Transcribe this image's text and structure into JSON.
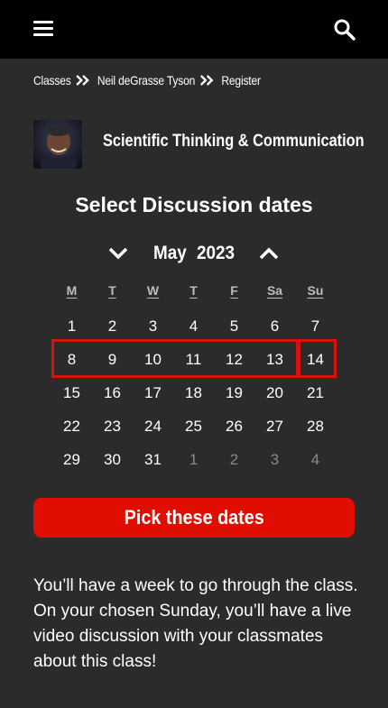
{
  "header": {
    "menu_icon": "hamburger-menu-icon",
    "search_icon": "search-icon"
  },
  "breadcrumb": {
    "items": [
      "Classes",
      "Neil deGrasse Tyson",
      "Register"
    ],
    "separator_icon": "double-chevron-right-icon"
  },
  "class": {
    "title": "Scientific Thinking & Communication",
    "thumbnail": "instructor-portrait"
  },
  "picker": {
    "heading": "Select Discussion dates",
    "month": "May",
    "year": "2023",
    "prev_icon": "chevron-down-icon",
    "next_icon": "chevron-up-icon",
    "weekdays": [
      "M",
      "T",
      "W",
      "T",
      "F",
      "Sa",
      "Su"
    ],
    "weeks": [
      [
        "1",
        "2",
        "3",
        "4",
        "5",
        "6",
        "7"
      ],
      [
        "8",
        "9",
        "10",
        "11",
        "12",
        "13",
        "14"
      ],
      [
        "15",
        "16",
        "17",
        "18",
        "19",
        "20",
        "21"
      ],
      [
        "22",
        "23",
        "24",
        "25",
        "26",
        "27",
        "28"
      ],
      [
        "29",
        "30",
        "31",
        "1",
        "2",
        "3",
        "4"
      ]
    ],
    "selected_range": [
      "8",
      "9",
      "10",
      "11",
      "12",
      "13"
    ],
    "selected_sunday": "14"
  },
  "cta_label": "Pick these dates",
  "info_text": "You’ll have a week to go through the class. On your chosen Sunday, you’ll have a live video discussion with your classmates about this class!",
  "colors": {
    "background": "#2b2b2b",
    "topbar": "#000000",
    "accent": "#e00d00"
  }
}
